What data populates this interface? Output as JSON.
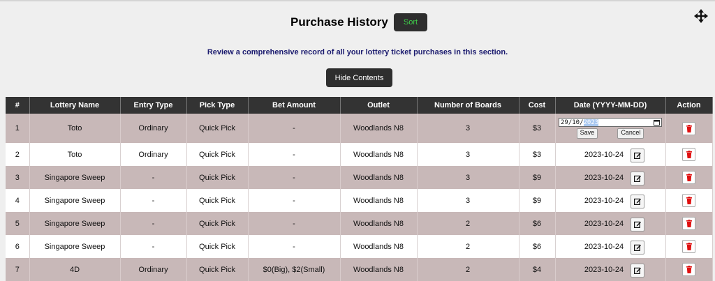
{
  "header": {
    "title": "Purchase History",
    "sort_label": "Sort",
    "subtitle": "Review a comprehensive record of all your lottery ticket purchases in this section.",
    "hide_label": "Hide Contents"
  },
  "table": {
    "columns": [
      "#",
      "Lottery Name",
      "Entry Type",
      "Pick Type",
      "Bet Amount",
      "Outlet",
      "Number of Boards",
      "Cost",
      "Date (YYYY-MM-DD)",
      "Action"
    ],
    "editing_row": {
      "date_day_month": "29/10/",
      "date_year": "2023",
      "save_label": "Save",
      "cancel_label": "Cancel"
    },
    "rows": [
      {
        "num": "1",
        "lottery": "Toto",
        "entry": "Ordinary",
        "pick": "Quick Pick",
        "bet": "-",
        "outlet": "Woodlands N8",
        "boards": "3",
        "cost": "$3",
        "date": ""
      },
      {
        "num": "2",
        "lottery": "Toto",
        "entry": "Ordinary",
        "pick": "Quick Pick",
        "bet": "-",
        "outlet": "Woodlands N8",
        "boards": "3",
        "cost": "$3",
        "date": "2023-10-24"
      },
      {
        "num": "3",
        "lottery": "Singapore Sweep",
        "entry": "-",
        "pick": "Quick Pick",
        "bet": "-",
        "outlet": "Woodlands N8",
        "boards": "3",
        "cost": "$9",
        "date": "2023-10-24"
      },
      {
        "num": "4",
        "lottery": "Singapore Sweep",
        "entry": "-",
        "pick": "Quick Pick",
        "bet": "-",
        "outlet": "Woodlands N8",
        "boards": "3",
        "cost": "$9",
        "date": "2023-10-24"
      },
      {
        "num": "5",
        "lottery": "Singapore Sweep",
        "entry": "-",
        "pick": "Quick Pick",
        "bet": "-",
        "outlet": "Woodlands N8",
        "boards": "2",
        "cost": "$6",
        "date": "2023-10-24"
      },
      {
        "num": "6",
        "lottery": "Singapore Sweep",
        "entry": "-",
        "pick": "Quick Pick",
        "bet": "-",
        "outlet": "Woodlands N8",
        "boards": "2",
        "cost": "$6",
        "date": "2023-10-24"
      },
      {
        "num": "7",
        "lottery": "4D",
        "entry": "Ordinary",
        "pick": "Quick Pick",
        "bet": "$0(Big), $2(Small)",
        "outlet": "Woodlands N8",
        "boards": "2",
        "cost": "$4",
        "date": "2023-10-24"
      }
    ]
  },
  "colors": {
    "header_bg": "#333333",
    "row_alt": "#c8b8b8",
    "sort_text": "#3fd04a",
    "delete_red": "#e01010"
  }
}
